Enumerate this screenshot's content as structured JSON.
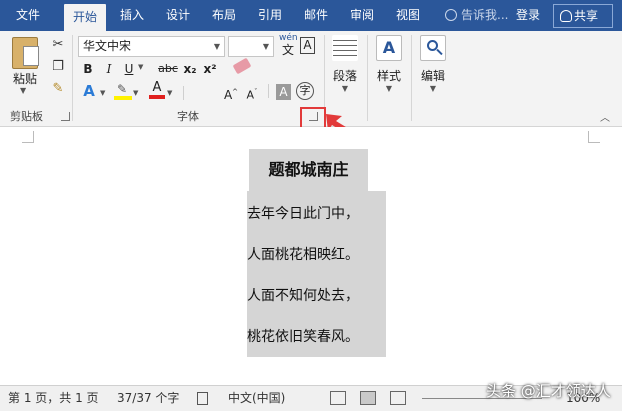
{
  "tabs": [
    "文件",
    "开始",
    "插入",
    "设计",
    "布局",
    "引用",
    "邮件",
    "审阅",
    "视图"
  ],
  "active_tab": "开始",
  "tell_me": "告诉我...",
  "login": "登录",
  "share": "共享",
  "clipboard": {
    "paste_label": "粘贴",
    "group_label": "剪贴板"
  },
  "font": {
    "font_name": "华文中宋",
    "font_size": "",
    "bold": "B",
    "italic": "I",
    "underline": "U",
    "strike": "abc",
    "subscript": "x₂",
    "superscript": "x²",
    "wen": "wén",
    "wen_char": "文",
    "grow": "A",
    "shrink": "A",
    "aa": "Aa",
    "group_label": "字体"
  },
  "paragraph": {
    "label": "段落"
  },
  "styles": {
    "label": "样式"
  },
  "editing": {
    "label": "编辑"
  },
  "document": {
    "title": "题都城南庄",
    "lines": [
      "去年今日此门中，",
      "人面桃花相映红。",
      "人面不知何处去，",
      "桃花依旧笑春风。"
    ]
  },
  "status": {
    "page": "第 1 页，共 1 页",
    "words": "37/37 个字",
    "language": "中文(中国)",
    "zoom": "100%"
  },
  "watermark": "头条 @汇才领达人",
  "colors": {
    "title_bar": "#2b579a",
    "highlight_box": "#e23a3a",
    "selection_gray": "#d5d5d5"
  }
}
